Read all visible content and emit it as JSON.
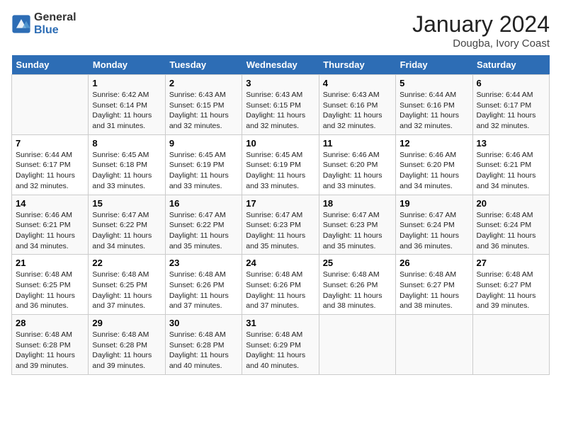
{
  "logo": {
    "line1": "General",
    "line2": "Blue"
  },
  "title": "January 2024",
  "subtitle": "Dougba, Ivory Coast",
  "days_of_week": [
    "Sunday",
    "Monday",
    "Tuesday",
    "Wednesday",
    "Thursday",
    "Friday",
    "Saturday"
  ],
  "weeks": [
    [
      {
        "day": "",
        "sunrise": "",
        "sunset": "",
        "daylight": ""
      },
      {
        "day": "1",
        "sunrise": "6:42 AM",
        "sunset": "6:14 PM",
        "daylight": "11 hours and 31 minutes."
      },
      {
        "day": "2",
        "sunrise": "6:43 AM",
        "sunset": "6:15 PM",
        "daylight": "11 hours and 32 minutes."
      },
      {
        "day": "3",
        "sunrise": "6:43 AM",
        "sunset": "6:15 PM",
        "daylight": "11 hours and 32 minutes."
      },
      {
        "day": "4",
        "sunrise": "6:43 AM",
        "sunset": "6:16 PM",
        "daylight": "11 hours and 32 minutes."
      },
      {
        "day": "5",
        "sunrise": "6:44 AM",
        "sunset": "6:16 PM",
        "daylight": "11 hours and 32 minutes."
      },
      {
        "day": "6",
        "sunrise": "6:44 AM",
        "sunset": "6:17 PM",
        "daylight": "11 hours and 32 minutes."
      }
    ],
    [
      {
        "day": "7",
        "sunrise": "6:44 AM",
        "sunset": "6:17 PM",
        "daylight": "11 hours and 32 minutes."
      },
      {
        "day": "8",
        "sunrise": "6:45 AM",
        "sunset": "6:18 PM",
        "daylight": "11 hours and 33 minutes."
      },
      {
        "day": "9",
        "sunrise": "6:45 AM",
        "sunset": "6:19 PM",
        "daylight": "11 hours and 33 minutes."
      },
      {
        "day": "10",
        "sunrise": "6:45 AM",
        "sunset": "6:19 PM",
        "daylight": "11 hours and 33 minutes."
      },
      {
        "day": "11",
        "sunrise": "6:46 AM",
        "sunset": "6:20 PM",
        "daylight": "11 hours and 33 minutes."
      },
      {
        "day": "12",
        "sunrise": "6:46 AM",
        "sunset": "6:20 PM",
        "daylight": "11 hours and 34 minutes."
      },
      {
        "day": "13",
        "sunrise": "6:46 AM",
        "sunset": "6:21 PM",
        "daylight": "11 hours and 34 minutes."
      }
    ],
    [
      {
        "day": "14",
        "sunrise": "6:46 AM",
        "sunset": "6:21 PM",
        "daylight": "11 hours and 34 minutes."
      },
      {
        "day": "15",
        "sunrise": "6:47 AM",
        "sunset": "6:22 PM",
        "daylight": "11 hours and 34 minutes."
      },
      {
        "day": "16",
        "sunrise": "6:47 AM",
        "sunset": "6:22 PM",
        "daylight": "11 hours and 35 minutes."
      },
      {
        "day": "17",
        "sunrise": "6:47 AM",
        "sunset": "6:23 PM",
        "daylight": "11 hours and 35 minutes."
      },
      {
        "day": "18",
        "sunrise": "6:47 AM",
        "sunset": "6:23 PM",
        "daylight": "11 hours and 35 minutes."
      },
      {
        "day": "19",
        "sunrise": "6:47 AM",
        "sunset": "6:24 PM",
        "daylight": "11 hours and 36 minutes."
      },
      {
        "day": "20",
        "sunrise": "6:48 AM",
        "sunset": "6:24 PM",
        "daylight": "11 hours and 36 minutes."
      }
    ],
    [
      {
        "day": "21",
        "sunrise": "6:48 AM",
        "sunset": "6:25 PM",
        "daylight": "11 hours and 36 minutes."
      },
      {
        "day": "22",
        "sunrise": "6:48 AM",
        "sunset": "6:25 PM",
        "daylight": "11 hours and 37 minutes."
      },
      {
        "day": "23",
        "sunrise": "6:48 AM",
        "sunset": "6:26 PM",
        "daylight": "11 hours and 37 minutes."
      },
      {
        "day": "24",
        "sunrise": "6:48 AM",
        "sunset": "6:26 PM",
        "daylight": "11 hours and 37 minutes."
      },
      {
        "day": "25",
        "sunrise": "6:48 AM",
        "sunset": "6:26 PM",
        "daylight": "11 hours and 38 minutes."
      },
      {
        "day": "26",
        "sunrise": "6:48 AM",
        "sunset": "6:27 PM",
        "daylight": "11 hours and 38 minutes."
      },
      {
        "day": "27",
        "sunrise": "6:48 AM",
        "sunset": "6:27 PM",
        "daylight": "11 hours and 39 minutes."
      }
    ],
    [
      {
        "day": "28",
        "sunrise": "6:48 AM",
        "sunset": "6:28 PM",
        "daylight": "11 hours and 39 minutes."
      },
      {
        "day": "29",
        "sunrise": "6:48 AM",
        "sunset": "6:28 PM",
        "daylight": "11 hours and 39 minutes."
      },
      {
        "day": "30",
        "sunrise": "6:48 AM",
        "sunset": "6:28 PM",
        "daylight": "11 hours and 40 minutes."
      },
      {
        "day": "31",
        "sunrise": "6:48 AM",
        "sunset": "6:29 PM",
        "daylight": "11 hours and 40 minutes."
      },
      {
        "day": "",
        "sunrise": "",
        "sunset": "",
        "daylight": ""
      },
      {
        "day": "",
        "sunrise": "",
        "sunset": "",
        "daylight": ""
      },
      {
        "day": "",
        "sunrise": "",
        "sunset": "",
        "daylight": ""
      }
    ]
  ]
}
